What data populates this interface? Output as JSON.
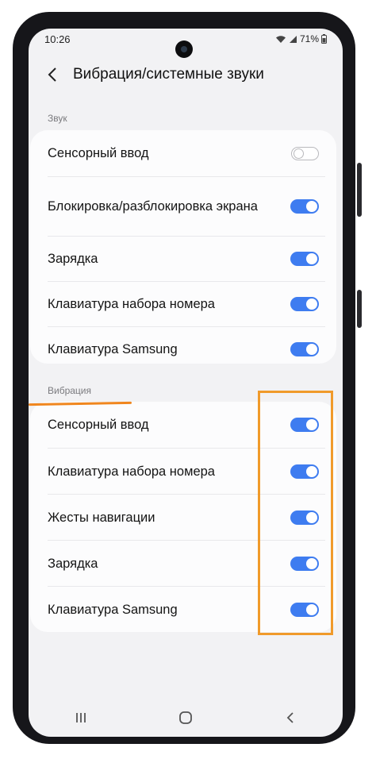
{
  "status_bar": {
    "time": "10:26",
    "battery": "71%"
  },
  "header": {
    "back_glyph": "❮",
    "title": "Вибрация/системные звуки"
  },
  "sound_section": {
    "label": "Звук",
    "items": [
      {
        "label": "Сенсорный ввод",
        "on": false
      },
      {
        "label": "Блокировка/разблокировка экрана",
        "on": true
      },
      {
        "label": "Зарядка",
        "on": true
      },
      {
        "label": "Клавиатура набора номера",
        "on": true
      },
      {
        "label": "Клавиатура Samsung",
        "on": true
      }
    ]
  },
  "vibration_section": {
    "label": "Вибрация",
    "items": [
      {
        "label": "Сенсорный ввод",
        "on": true
      },
      {
        "label": "Клавиатура набора номера",
        "on": true
      },
      {
        "label": "Жесты навигации",
        "on": true
      },
      {
        "label": "Зарядка",
        "on": true
      },
      {
        "label": "Клавиатура Samsung",
        "on": true
      }
    ]
  },
  "navbar": {
    "recents": "⦀",
    "home": "○",
    "back": "❮"
  },
  "colors": {
    "accent": "#3e7cf0",
    "highlight": "#f09a2a"
  }
}
